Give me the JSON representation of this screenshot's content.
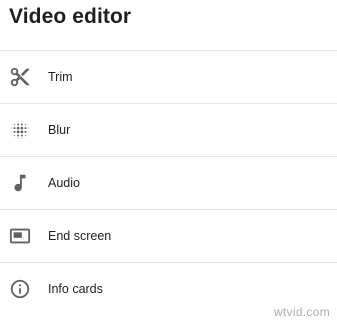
{
  "header": {
    "title": "Video editor"
  },
  "menu": {
    "items": [
      {
        "label": "Trim",
        "icon": "scissors-icon"
      },
      {
        "label": "Blur",
        "icon": "blur-icon"
      },
      {
        "label": "Audio",
        "icon": "music-note-icon"
      },
      {
        "label": "End screen",
        "icon": "end-screen-icon"
      },
      {
        "label": "Info cards",
        "icon": "info-icon"
      }
    ]
  },
  "watermark": "wtvid.com",
  "colors": {
    "text": "#212121",
    "icon": "#606060",
    "divider": "#e6e6e6"
  }
}
